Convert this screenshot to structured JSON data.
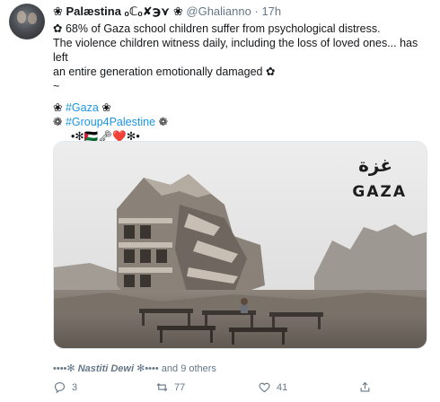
{
  "tweet": {
    "display_name": "❀ Palæstina ₒℂₒ✘℈⋎ ❀",
    "handle": "@Ghalianno",
    "separator": "·",
    "time": "17h",
    "lines": [
      "✿ 68% of Gaza school children suffer from psychological distress.",
      "The violence children witness daily, including the loss of loved ones... has left",
      "an entire generation emotionally damaged ✿",
      "~"
    ],
    "hashtag_line_1": {
      "prefix": "❀ ",
      "tag": "#Gaza",
      "suffix": " ❀"
    },
    "hashtag_line_2": {
      "prefix": "❁ ",
      "tag": "#Group4Palestine",
      "suffix": " ❁"
    },
    "emoji_line": "•✻🇵🇸🗝❤️✻•",
    "image_text": {
      "arabic": "غزة",
      "latin": "GAZA"
    },
    "liked_by": {
      "prefix": "••••✻ ",
      "name": "Nastiti Dewi",
      "suffix": " ✻•••• and 9 others"
    },
    "actions": {
      "reply_count": "3",
      "retweet_count": "77",
      "like_count": "41"
    }
  },
  "colors": {
    "link": "#1b95e0",
    "muted": "#657786",
    "text": "#14171a"
  },
  "icons": {
    "reply": "reply-icon",
    "retweet": "retweet-icon",
    "like": "heart-icon",
    "share": "share-icon"
  }
}
